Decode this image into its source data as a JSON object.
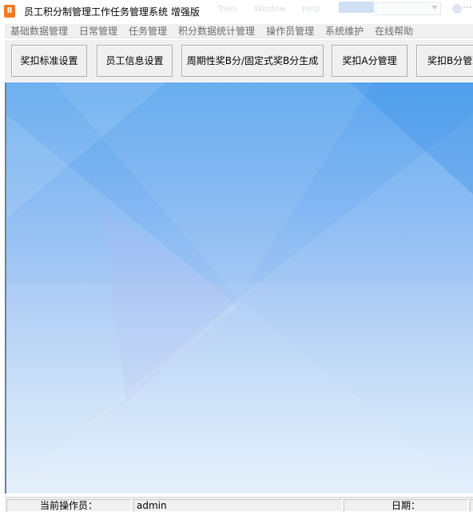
{
  "window": {
    "title": "员工积分制管理工作任务管理系统  增强版",
    "icon_glyph": "8",
    "icon_color": "#f47a20"
  },
  "background_taskbar": {
    "items": [
      "Tools",
      "Window",
      "Help"
    ]
  },
  "menu": {
    "items": [
      "基础数据管理",
      "日常管理",
      "任务管理",
      "积分数据统计管理",
      "操作员管理",
      "系统维护",
      "在线帮助"
    ]
  },
  "toolbar": {
    "buttons": [
      "奖扣标准设置",
      "员工信息设置",
      "周期性奖B分/固定式奖B分生成",
      "奖扣A分管理",
      "奖扣B分管理"
    ]
  },
  "status": {
    "operator_label": "当前操作员：",
    "operator_value": "admin",
    "date_label": "日期："
  },
  "colors": {
    "workspace_top": "#5ea8ee",
    "workspace_bottom": "#e2eefb",
    "chrome": "#f0f0f0"
  }
}
